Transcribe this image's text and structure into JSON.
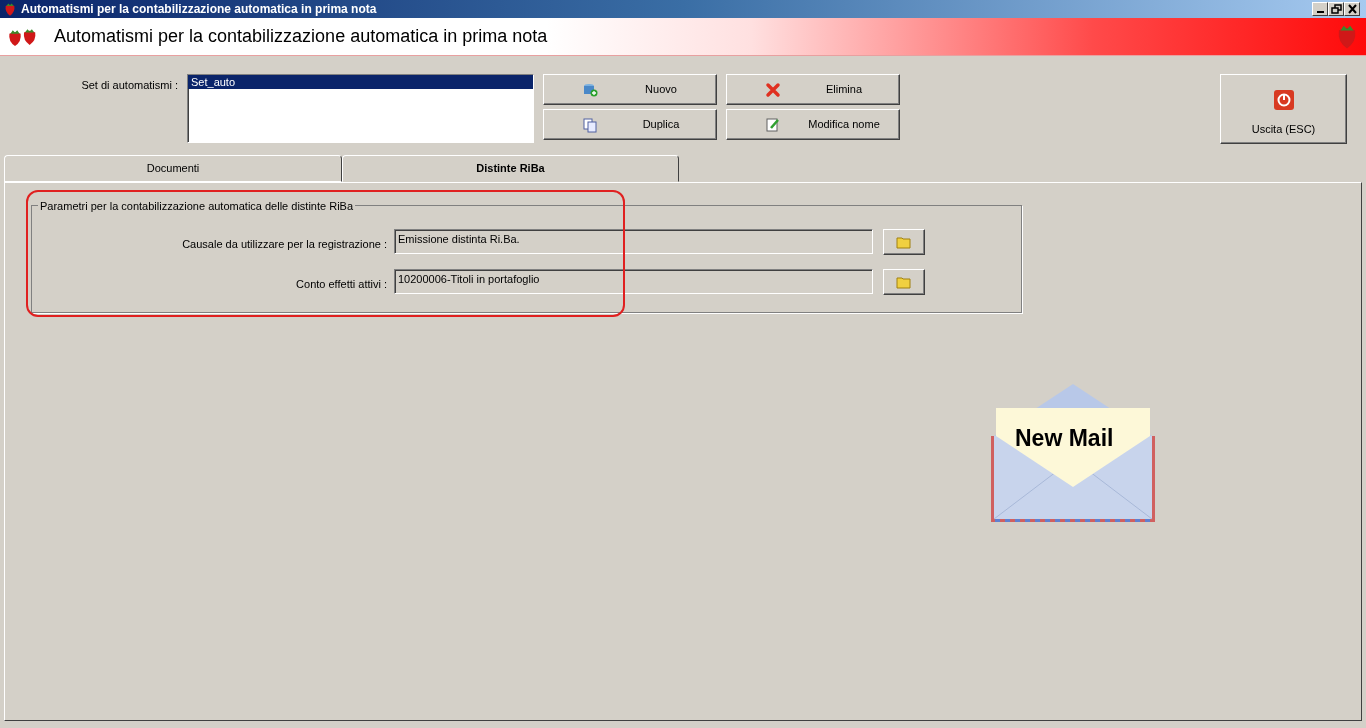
{
  "window": {
    "title": "Automatismi per la contabilizzazione automatica in prima nota"
  },
  "header": {
    "title": "Automatismi per la contabilizzazione automatica in prima nota"
  },
  "automation_sets": {
    "label": "Set di automatismi :",
    "items": [
      {
        "label": "Set_auto",
        "selected": true
      }
    ]
  },
  "actions": [
    {
      "kind": "new",
      "label": "Nuovo"
    },
    {
      "kind": "delete",
      "label": "Elimina"
    },
    {
      "kind": "duplicate",
      "label": "Duplica"
    },
    {
      "kind": "rename",
      "label": "Modifica nome"
    }
  ],
  "exit_button": {
    "label": "Uscita (ESC)"
  },
  "tabs": [
    {
      "label": "Documenti",
      "selected": false
    },
    {
      "label": "Distinte RiBa",
      "selected": true
    }
  ],
  "group": {
    "title": "Parametri per la contabilizzazione automatica delle distinte RiBa",
    "fields": [
      {
        "label": "Causale da utilizzare per la registrazione :",
        "value": "Emissione distinta Ri.Ba."
      },
      {
        "label": "Conto effetti attivi :",
        "value": "10200006-Titoli in portafoglio"
      }
    ]
  },
  "notification": {
    "text": "New Mail"
  }
}
